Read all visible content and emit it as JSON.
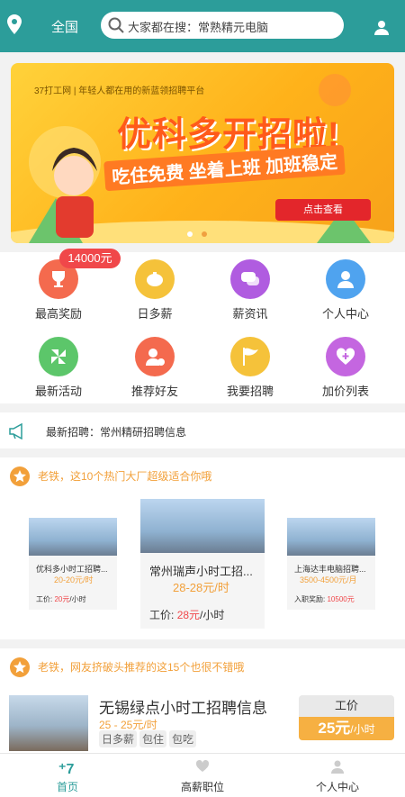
{
  "header": {
    "city": "全国",
    "search_placeholder": "大家都在搜：常熟精元电脑"
  },
  "banner": {
    "brand": "37打工网 | 年轻人都在用的新蓝领招聘平台",
    "headline": "优科多开招啦!",
    "subline": "吃住免费 坐着上班 加班稳定",
    "button": "点击查看"
  },
  "menu": [
    {
      "label": "最高奖励",
      "color": "#f46a4e",
      "icon": "trophy-icon"
    },
    {
      "label": "日多薪",
      "color": "#f5c23a",
      "icon": "piggy-bank-icon"
    },
    {
      "label": "薪资讯",
      "color": "#b05ce0",
      "icon": "chat-icon"
    },
    {
      "label": "个人中心",
      "color": "#4fa3ef",
      "icon": "person-icon"
    },
    {
      "label": "最新活动",
      "color": "#5cc66a",
      "icon": "pinwheel-icon"
    },
    {
      "label": "推荐好友",
      "color": "#f46a4e",
      "icon": "add-friend-icon"
    },
    {
      "label": "我要招聘",
      "color": "#f5c23a",
      "icon": "flag-icon"
    },
    {
      "label": "加价列表",
      "color": "#c466e0",
      "icon": "heart-plus-icon"
    }
  ],
  "reward_badge": "14000元",
  "news": {
    "text": "最新招聘：常州精研招聘信息"
  },
  "hot_section": {
    "title": "老铁，这10个热门大厂超级适合你哦",
    "cards": [
      {
        "title": "优科多小时工招聘...",
        "price": "20-20元/时",
        "wage_label": "工价:",
        "wage_value": "20元",
        "wage_unit": "/小时"
      },
      {
        "title": "常州瑞声小时工招...",
        "price": "28-28元/时",
        "wage_label": "工价:",
        "wage_value": "28元",
        "wage_unit": "/小时"
      },
      {
        "title": "上海达丰电脑招聘...",
        "price": "3500-4500元/月",
        "wage_label": "入职奖励:",
        "wage_value": "10500元",
        "wage_unit": ""
      }
    ]
  },
  "list_section": {
    "title": "老铁，网友挤破头推荐的这15个也很不错哦",
    "items": [
      {
        "title": "无锡绿点小时工招聘信息",
        "price": "25 - 25元/时",
        "tags": [
          "日多薪",
          "包住",
          "包吃"
        ],
        "wage_label": "工价",
        "wage_value": "25元",
        "wage_unit": "/小时"
      }
    ]
  },
  "tabbar": [
    {
      "label": "首页",
      "active": true
    },
    {
      "label": "高薪职位",
      "active": false
    },
    {
      "label": "个人中心",
      "active": false
    }
  ],
  "colors": {
    "primary": "#2c9d9a",
    "accent": "#f2a03a",
    "red": "#f0474a"
  }
}
